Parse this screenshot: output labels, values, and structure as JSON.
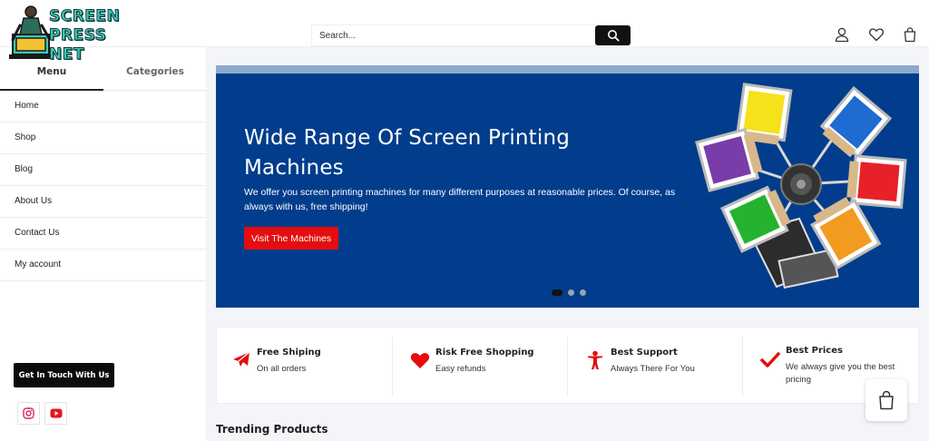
{
  "header": {
    "logo_lines": [
      "SCREEN",
      "PRESS",
      "NET"
    ],
    "search": {
      "placeholder": "Search..."
    },
    "icons": [
      "search-icon",
      "user-icon",
      "heart-icon",
      "bag-icon"
    ]
  },
  "sidebar": {
    "tabs": [
      {
        "label": "Menu",
        "active": true
      },
      {
        "label": "Categories",
        "active": false
      }
    ],
    "items": [
      {
        "label": "Home"
      },
      {
        "label": "Shop"
      },
      {
        "label": "Blog"
      },
      {
        "label": "About Us"
      },
      {
        "label": "Contact Us"
      },
      {
        "label": "My account"
      }
    ],
    "touch_button": "Get In Touch With Us",
    "social_icons": [
      "instagram-icon",
      "youtube-icon"
    ]
  },
  "hero": {
    "title": "Wide Range Of Screen Printing Machines",
    "description": "We offer you screen printing machines for many different purposes at reasonable prices. Of course, as always with us, free shipping!",
    "button": "Visit The Machines",
    "slides": 3,
    "active_slide": 1,
    "colors": {
      "background": "#013d8c",
      "button": "#e50d0d"
    }
  },
  "features": [
    {
      "icon": "airplane-icon",
      "title": "Free Shiping",
      "subtitle": "On all orders"
    },
    {
      "icon": "heart-icon",
      "title": "Risk Free Shopping",
      "subtitle": "Easy refunds"
    },
    {
      "icon": "support-person-icon",
      "title": "Best Support",
      "subtitle": "Always There For You"
    },
    {
      "icon": "checkmark-icon",
      "title": "Best Prices",
      "subtitle": "We always give you the best pricing"
    }
  ],
  "trending": {
    "title": "Trending Products"
  },
  "accent_color": "#e50d0d"
}
